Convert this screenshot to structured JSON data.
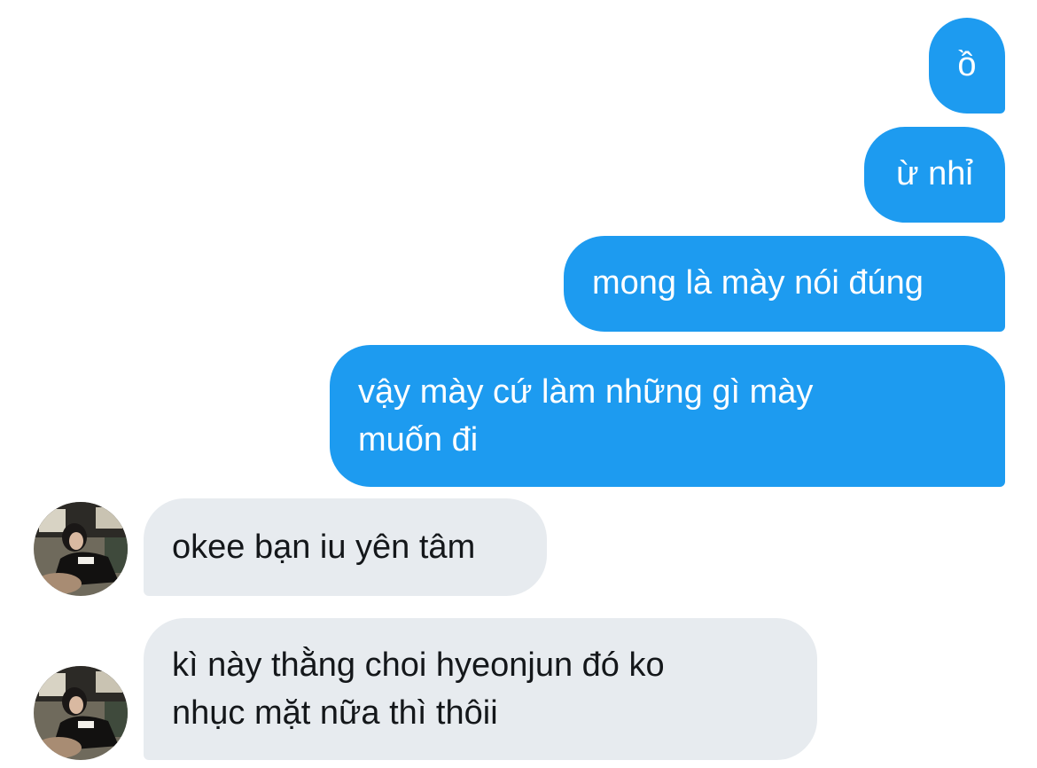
{
  "conversation": {
    "outgoing_messages": [
      "ồ",
      "ừ nhỉ",
      "mong là mày nói đúng",
      "vậy mày cứ làm những gì mày muốn đi"
    ],
    "incoming_messages": [
      "okee bạn iu yên tâm",
      "kì này thằng choi hyeonjun đó ko nhục mặt nữa thì thôii"
    ]
  },
  "colors": {
    "outgoing_bubble": "#1d9bf0",
    "incoming_bubble": "#e7ebef",
    "outgoing_text": "#ffffff",
    "incoming_text": "#14171a"
  }
}
